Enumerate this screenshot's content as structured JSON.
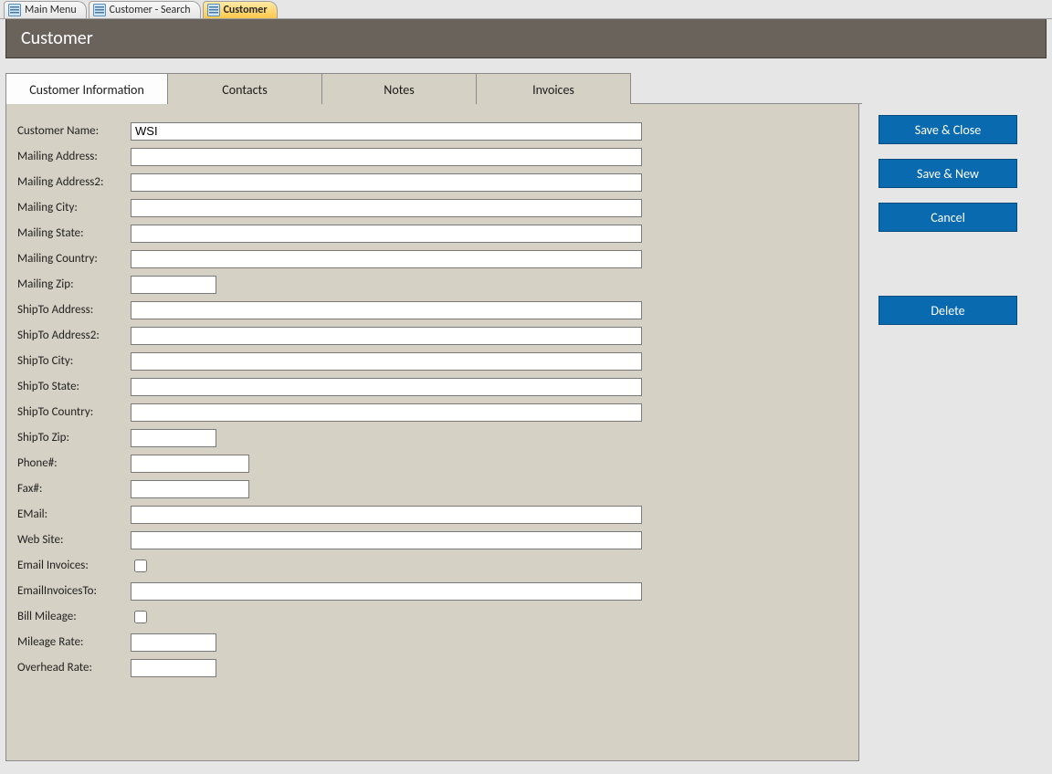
{
  "top_tabs": [
    {
      "label": "Main Menu",
      "active": false
    },
    {
      "label": "Customer - Search",
      "active": false
    },
    {
      "label": "Customer",
      "active": true
    }
  ],
  "banner": {
    "title": "Customer"
  },
  "form_tabs": [
    {
      "label": "Customer Information",
      "active": true
    },
    {
      "label": "Contacts",
      "active": false
    },
    {
      "label": "Notes",
      "active": false
    },
    {
      "label": "Invoices",
      "active": false
    }
  ],
  "fields": {
    "customer_name": {
      "label": "Customer Name:",
      "value": "WSI",
      "width": "long"
    },
    "mailing_address": {
      "label": "Mailing Address:",
      "value": "",
      "width": "long"
    },
    "mailing_address2": {
      "label": "Mailing Address2:",
      "value": "",
      "width": "long"
    },
    "mailing_city": {
      "label": "Mailing City:",
      "value": "",
      "width": "long"
    },
    "mailing_state": {
      "label": "Mailing State:",
      "value": "",
      "width": "long"
    },
    "mailing_country": {
      "label": "Mailing Country:",
      "value": "",
      "width": "long"
    },
    "mailing_zip": {
      "label": "Mailing Zip:",
      "value": "",
      "width": "zip"
    },
    "shipto_address": {
      "label": "ShipTo Address:",
      "value": "",
      "width": "long"
    },
    "shipto_address2": {
      "label": "ShipTo Address2:",
      "value": "",
      "width": "long"
    },
    "shipto_city": {
      "label": "ShipTo City:",
      "value": "",
      "width": "long"
    },
    "shipto_state": {
      "label": "ShipTo State:",
      "value": "",
      "width": "long"
    },
    "shipto_country": {
      "label": "ShipTo Country:",
      "value": "",
      "width": "long"
    },
    "shipto_zip": {
      "label": "ShipTo Zip:",
      "value": "",
      "width": "zip"
    },
    "phone": {
      "label": "Phone#:",
      "value": "",
      "width": "phone"
    },
    "fax": {
      "label": "Fax#:",
      "value": "",
      "width": "phone"
    },
    "email": {
      "label": "EMail:",
      "value": "",
      "width": "long"
    },
    "website": {
      "label": "Web Site:",
      "value": "",
      "width": "long"
    },
    "email_invoices": {
      "label": "Email Invoices:",
      "checked": false,
      "type": "check"
    },
    "email_invoices_to": {
      "label": "EmailInvoicesTo:",
      "value": "",
      "width": "long"
    },
    "bill_mileage": {
      "label": "Bill Mileage:",
      "checked": false,
      "type": "check"
    },
    "mileage_rate": {
      "label": "Mileage Rate:",
      "value": "",
      "width": "zip"
    },
    "overhead_rate": {
      "label": "Overhead Rate:",
      "value": "",
      "width": "zip"
    }
  },
  "field_order": [
    "customer_name",
    "mailing_address",
    "mailing_address2",
    "mailing_city",
    "mailing_state",
    "mailing_country",
    "mailing_zip",
    "shipto_address",
    "shipto_address2",
    "shipto_city",
    "shipto_state",
    "shipto_country",
    "shipto_zip",
    "phone",
    "fax",
    "email",
    "website",
    "email_invoices",
    "email_invoices_to",
    "bill_mileage",
    "mileage_rate",
    "overhead_rate"
  ],
  "buttons": {
    "save_close": "Save & Close",
    "save_new": "Save & New",
    "cancel": "Cancel",
    "delete": "Delete"
  }
}
